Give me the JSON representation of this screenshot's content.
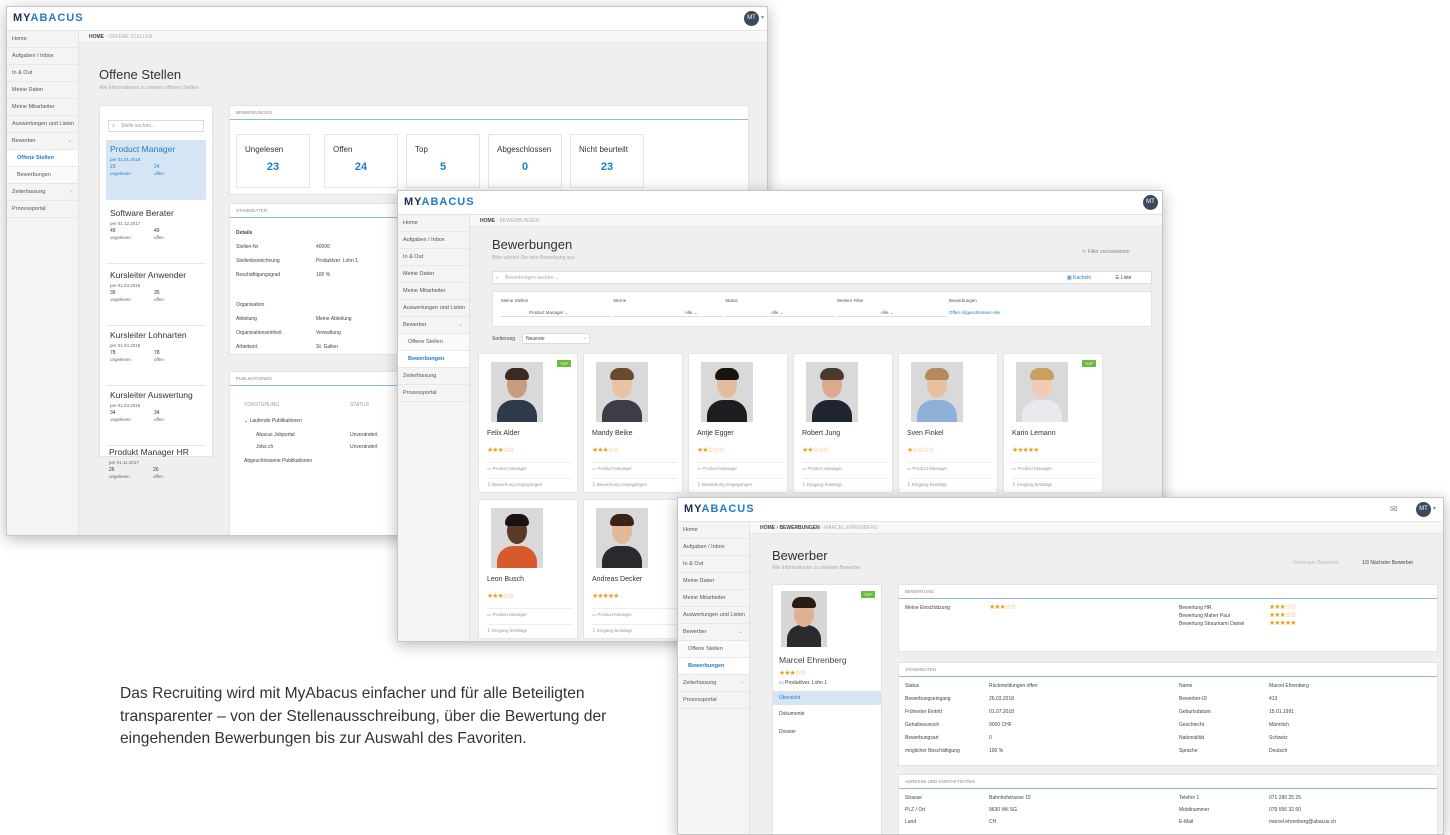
{
  "brand": {
    "logo_a": "MY",
    "logo_b": "ABACUS",
    "avatar": "MT"
  },
  "sidebar1": [
    "Home",
    "Aufgaben / Inbox",
    "In & Out",
    "Meine Daten",
    "Meine Mitarbeiter",
    "Auswertungen und Listen",
    "Bewerber",
    "Offene Stellen",
    "Bewerbungen",
    "Zeiterfassung",
    "Prozessportal"
  ],
  "w1": {
    "crumb_home": "HOME",
    "crumb_rest": "› OFFENE STELLEN",
    "title": "Offene Stellen",
    "subtitle": "Alle Informationen zu meinen offenen Stellen",
    "search": "Stelle suchen...",
    "jobs": [
      {
        "title": "Product Manager",
        "date": "per 01.01.2018",
        "n1": "23",
        "n2": "24",
        "l1": "ungelesen",
        "l2": "offen"
      },
      {
        "title": "Software Berater",
        "date": "per 01.12.2017",
        "n1": "49",
        "n2": "49",
        "l1": "ungelesen",
        "l2": "offen"
      },
      {
        "title": "Kursleiter Anwender",
        "date": "per 01.04.2018",
        "n1": "35",
        "n2": "35",
        "l1": "ungelesen",
        "l2": "offen"
      },
      {
        "title": "Kursleiter Lohnarten",
        "date": "per 01.04.2018",
        "n1": "78",
        "n2": "78",
        "l1": "ungelesen",
        "l2": "offen"
      },
      {
        "title": "Kursleiter Auswertung",
        "date": "per 01.04.2018",
        "n1": "34",
        "n2": "34",
        "l1": "ungelesen",
        "l2": "offen"
      },
      {
        "title": "Produkt Manager HR",
        "date": "per 01.11.2017",
        "n1": "26",
        "n2": "26",
        "l1": "ungelesen",
        "l2": "offen"
      }
    ],
    "bew_head": "BEWERBUNGEN",
    "stats": [
      {
        "label": "Ungelesen",
        "value": "23"
      },
      {
        "label": "Offen",
        "value": "24"
      },
      {
        "label": "Top",
        "value": "5"
      },
      {
        "label": "Abgeschlossen",
        "value": "0"
      },
      {
        "label": "Nicht beurteilt",
        "value": "23"
      }
    ],
    "stamm_head": "STAMMDATEN",
    "details_label": "Details",
    "details": [
      [
        "Stellen-Nr",
        "40006"
      ],
      [
        "Stellenbezeichnung",
        "Produktver. Lohn 1"
      ],
      [
        "Beschäftigungsgrad",
        "100 %"
      ]
    ],
    "org_label": "Organisation",
    "org": [
      [
        "Abteilung",
        "Meine Abteilung"
      ],
      [
        "Organisationseinheit",
        "Verwaltung"
      ],
      [
        "Arbeitsort",
        "St. Gallen"
      ]
    ],
    "pub_head": "PUBLIKATIONEN",
    "pub_col1": "VORSTEHUNG",
    "pub_col2": "STATUS",
    "pub_group1": "⌄ Laufende Publikationen",
    "pubs": [
      [
        "Abacus Jobportal",
        "Unverändert"
      ],
      [
        "Jobs.ch",
        "Unverändert"
      ]
    ],
    "pub_group2": "Abgeschlossene Publikationen"
  },
  "w2": {
    "crumb_home": "HOME",
    "crumb_rest": "› BEWERBUNGEN",
    "title": "Bewerbungen",
    "subtitle": "Bitte wählen Sie eine Bewerbung aus",
    "reset": "Filter zurücksetzen",
    "search": "Bewerbungen suchen ...",
    "view_kacheln": "Kacheln",
    "view_liste": "Liste",
    "filters": [
      {
        "label": "Meine Stellen",
        "value": "Product Manager ⌄"
      },
      {
        "label": "Sterne",
        "value": "Alle ⌄"
      },
      {
        "label": "Status",
        "value": "Alle ⌄"
      },
      {
        "label": "Weitere Filter",
        "value": "Alle ⌄"
      },
      {
        "label": "Bewerbungen",
        "value": "Offen   Abgeschlossen   Alle"
      }
    ],
    "sort_label": "Sortierung",
    "sort_value": "Neueste",
    "top": "TOP",
    "cards": [
      {
        "name": "Felix Alder",
        "stars": "★★★☆☆",
        "job": "Product Manager",
        "ev": "Bewerbung eingegangen"
      },
      {
        "name": "Mandy Beike",
        "stars": "★★★☆☆",
        "job": "Product Manager",
        "ev": "Bewerbung eingegangen"
      },
      {
        "name": "Antje Egger",
        "stars": "★★☆☆☆",
        "job": "Product Manager",
        "ev": "Bewerbung eingegangen"
      },
      {
        "name": "Robert Jung",
        "stars": "★★☆☆☆",
        "job": "Product Manager",
        "ev": "Eingang bestätigt"
      },
      {
        "name": "Sven Finkel",
        "stars": "★☆☆☆☆",
        "job": "Product Manager",
        "ev": "Eingang bestätigt"
      },
      {
        "name": "Karin Lemann",
        "stars": "★★★★★",
        "job": "Product Manager",
        "ev": "Eingang bestätigt"
      },
      {
        "name": "Leon Busch",
        "stars": "★★★☆☆",
        "job": "Product Manager",
        "ev": "Eingang bestätigt"
      },
      {
        "name": "Andreas Decker",
        "stars": "★★★★★",
        "job": "Product Manager",
        "ev": "Eingang bestätigt"
      }
    ]
  },
  "w3": {
    "crumb_home": "HOME",
    "crumb_mid": "› BEWERBUNGEN",
    "crumb_rest": "› MARCEL EHRENBERG",
    "title": "Bewerber",
    "subtitle": "Alle Informationen zu meinem Bewerber",
    "prev": "‹ Vorheriger Bewerber",
    "next": "1/3  Nächster Bewerber",
    "top": "TOP",
    "name": "Marcel Ehrenberg",
    "stars": "★★★☆☆",
    "job": "Produktver. Lohn 1",
    "tabs": [
      "Übersicht",
      "Dokumente",
      "Dossier"
    ],
    "rating_head": "BEWERTUNG",
    "my_rating_label": "Meine Einschätzung",
    "my_rating": "★★★☆☆",
    "ratings": [
      [
        "Bewertung HR",
        "★★★☆☆"
      ],
      [
        "Bewertung Maher Paul",
        "★★★☆☆"
      ],
      [
        "Bewertung Straumann Daniel",
        "★★★★★"
      ]
    ],
    "stamm_head": "STAMMDATEN",
    "left": [
      [
        "Status",
        "Rückmeldungen offen"
      ],
      [
        "Bewerbungseingang",
        "26.03.2018"
      ],
      [
        "Frühester Eintritt",
        "01.07.2018"
      ],
      [
        "Gehaltswunsch",
        "9000 CHF"
      ],
      [
        "Bewerbungsart",
        "0"
      ],
      [
        "möglicher Beschäftigung",
        "100 %"
      ]
    ],
    "right": [
      [
        "Name",
        "Marcel Ehrenberg"
      ],
      [
        "Bewerber-ID",
        "413"
      ],
      [
        "Geburtsdatum",
        "15.01.1991"
      ],
      [
        "Geschlecht",
        "Männlich"
      ],
      [
        "Nationalität",
        "Schweiz"
      ],
      [
        "Sprache",
        "Deutsch"
      ]
    ],
    "addr_head": "ADRESSE UND KONTAKTDATEN",
    "addr_left": [
      [
        "Strasse",
        "Bahnhofstrasse 15"
      ],
      [
        "PLZ / Ort",
        "9630 Wil SG"
      ],
      [
        "Land",
        "CH"
      ]
    ],
    "addr_right": [
      [
        "Telefon 1",
        "071 290 25 25"
      ],
      [
        "Mobilnummer",
        "079 556 32 60"
      ],
      [
        "E-Mail",
        "marcel.ehrenberg@abacus.ch"
      ]
    ]
  },
  "caption": "Das Recruiting wird mit MyAbacus einfacher und für alle Beteiligten transparenter – von der Stellenausschreibung, über die Bewertung der eingehenden Bewerbungen bis zur Auswahl des Favoriten."
}
